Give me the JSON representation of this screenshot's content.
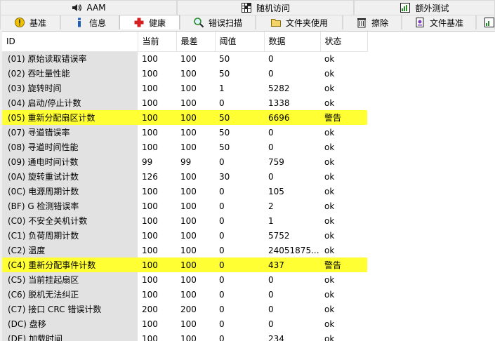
{
  "colors": {
    "warning_row": "#ffff33",
    "id_column": "#e2e2e2"
  },
  "tabs_row1": [
    {
      "label": "AAM",
      "icon": "speaker-icon"
    },
    {
      "label": "随机访问",
      "icon": "grid-icon"
    },
    {
      "label": "额外测试",
      "icon": "chart-icon"
    }
  ],
  "tabs_row2": [
    {
      "label": "基准",
      "icon": "warning-icon"
    },
    {
      "label": "信息",
      "icon": "info-icon"
    },
    {
      "label": "健康",
      "icon": "health-cross-icon",
      "active": true
    },
    {
      "label": "错误扫描",
      "icon": "magnifier-icon"
    },
    {
      "label": "文件夹使用",
      "icon": "folder-icon"
    },
    {
      "label": "擦除",
      "icon": "trash-icon"
    },
    {
      "label": "文件基准",
      "icon": "file-benchmark-icon"
    },
    {
      "label": "",
      "icon": "chart-icon"
    }
  ],
  "table": {
    "headers": [
      "ID",
      "当前",
      "最差",
      "阈值",
      "数据",
      "状态"
    ],
    "rows": [
      [
        "(01) 原始读取错误率",
        "100",
        "100",
        "50",
        "0",
        "ok"
      ],
      [
        "(02) 吞吐量性能",
        "100",
        "100",
        "50",
        "0",
        "ok"
      ],
      [
        "(03) 旋转时间",
        "100",
        "100",
        "1",
        "5282",
        "ok"
      ],
      [
        "(04) 启动/停止计数",
        "100",
        "100",
        "0",
        "1338",
        "ok"
      ],
      [
        "(05) 重新分配扇区计数",
        "100",
        "100",
        "50",
        "6696",
        "警告"
      ],
      [
        "(07) 寻道错误率",
        "100",
        "100",
        "50",
        "0",
        "ok"
      ],
      [
        "(08) 寻道时间性能",
        "100",
        "100",
        "50",
        "0",
        "ok"
      ],
      [
        "(09) 通电时间计数",
        "99",
        "99",
        "0",
        "759",
        "ok"
      ],
      [
        "(0A) 旋转重试计数",
        "126",
        "100",
        "30",
        "0",
        "ok"
      ],
      [
        "(0C) 电源周期计数",
        "100",
        "100",
        "0",
        "105",
        "ok"
      ],
      [
        "(BF) G 检测错误率",
        "100",
        "100",
        "0",
        "2",
        "ok"
      ],
      [
        "(C0) 不安全关机计数",
        "100",
        "100",
        "0",
        "1",
        "ok"
      ],
      [
        "(C1) 负荷周期计数",
        "100",
        "100",
        "0",
        "5752",
        "ok"
      ],
      [
        "(C2) 温度",
        "100",
        "100",
        "0",
        "24051875...",
        "ok"
      ],
      [
        "(C4) 重新分配事件计数",
        "100",
        "100",
        "0",
        "437",
        "警告"
      ],
      [
        "(C5) 当前挂起扇区",
        "100",
        "100",
        "0",
        "0",
        "ok"
      ],
      [
        "(C6) 脱机无法纠正",
        "100",
        "100",
        "0",
        "0",
        "ok"
      ],
      [
        "(C7) 接口 CRC 错误计数",
        "200",
        "200",
        "0",
        "0",
        "ok"
      ],
      [
        "(DC) 盘移",
        "100",
        "100",
        "0",
        "0",
        "ok"
      ],
      [
        "(DE) 加载时间",
        "100",
        "100",
        "0",
        "234",
        "ok"
      ]
    ],
    "warn_status": "警告"
  }
}
